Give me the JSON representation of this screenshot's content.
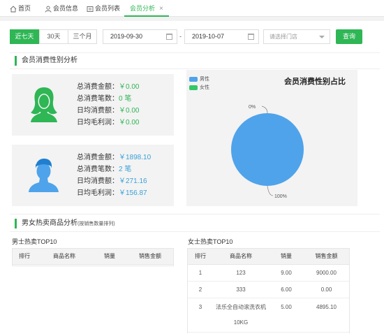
{
  "tabs": [
    {
      "label": "首页",
      "icon": "home-icon"
    },
    {
      "label": "会员信息",
      "icon": "user-icon"
    },
    {
      "label": "会员列表",
      "icon": "list-icon"
    },
    {
      "label": "会员分析",
      "icon": "",
      "active": true,
      "close": "×"
    }
  ],
  "filter": {
    "ranges": [
      "近七天",
      "30天",
      "三个月"
    ],
    "start_date": "2019-09-30",
    "end_date": "2019-10-07",
    "separator": "-",
    "store_placeholder": "请选择门店",
    "query_label": "查询"
  },
  "gender_section": {
    "title": "会员消费性别分析"
  },
  "female_card": {
    "rows": [
      {
        "label": "总消费金额：",
        "value": "￥0.00"
      },
      {
        "label": "总消费笔数：",
        "value": "0 笔"
      },
      {
        "label": "日均消费额：",
        "value": "￥0.00"
      },
      {
        "label": "日均毛利润：",
        "value": "￥0.00"
      }
    ]
  },
  "male_card": {
    "rows": [
      {
        "label": "总消费金额：",
        "value": "￥1898.10"
      },
      {
        "label": "总消费笔数：",
        "value": "2 笔"
      },
      {
        "label": "日均消费额：",
        "value": "￥271.16"
      },
      {
        "label": "日均毛利润：",
        "value": "￥156.87"
      }
    ]
  },
  "chart_data": {
    "type": "pie",
    "title": "会员消费性别占比",
    "legend_position": "top-left",
    "slices": [
      {
        "name": "男性",
        "value": 100,
        "label": "100%",
        "color": "#4fa3ea"
      },
      {
        "name": "女性",
        "value": 0,
        "label": "0%",
        "color": "#34c76a"
      }
    ]
  },
  "hot_section": {
    "title": "男女热卖商品分析",
    "note": "(按销售数量排列)"
  },
  "male_top": {
    "title": "男士热卖TOP10",
    "headers": [
      "排行",
      "商品名称",
      "销量",
      "销售金额"
    ],
    "rows": []
  },
  "female_top": {
    "title": "女士热卖TOP10",
    "headers": [
      "排行",
      "商品名称",
      "销量",
      "销售金额"
    ],
    "rows": [
      [
        "1",
        "123",
        "9.00",
        "9000.00"
      ],
      [
        "2",
        "333",
        "6.00",
        "0.00"
      ],
      [
        "3",
        "法乐全自动滚洗衣机 10KG",
        "5.00",
        "4895.10"
      ]
    ]
  },
  "colors": {
    "accent": "#2fb655",
    "male_value": "#3aa0d8"
  }
}
